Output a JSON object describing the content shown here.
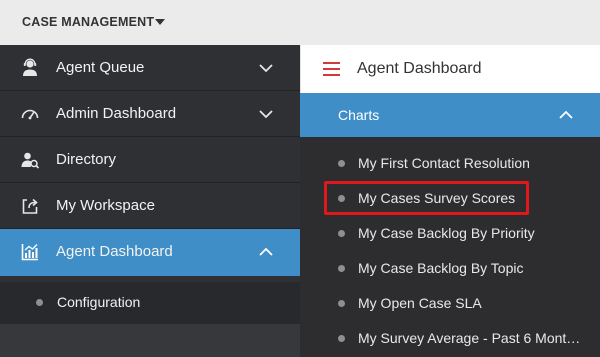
{
  "app": {
    "title": "CASE MANAGEMENT"
  },
  "sidebar": {
    "items": [
      {
        "label": "Agent Queue",
        "icon": "agent-icon",
        "expandable": true
      },
      {
        "label": "Admin Dashboard",
        "icon": "gauge-icon",
        "expandable": true
      },
      {
        "label": "Directory",
        "icon": "directory-search-icon",
        "expandable": false
      },
      {
        "label": "My Workspace",
        "icon": "workspace-export-icon",
        "expandable": false
      },
      {
        "label": "Agent Dashboard",
        "icon": "chart-icon",
        "expandable": true,
        "expanded": true
      }
    ],
    "subitems": [
      {
        "label": "Configuration"
      }
    ]
  },
  "panel": {
    "title": "Agent Dashboard",
    "section": {
      "label": "Charts",
      "expanded": true
    },
    "items": [
      {
        "label": "My First Contact Resolution"
      },
      {
        "label": "My Cases Survey Scores",
        "highlighted": true
      },
      {
        "label": "My Case Backlog By Priority"
      },
      {
        "label": "My Case Backlog By Topic"
      },
      {
        "label": "My Open Case SLA"
      },
      {
        "label": "My Survey Average - Past 6 Mont…"
      }
    ]
  },
  "colors": {
    "accent": "#3f8ec7",
    "sidebar_bg": "#2f3033",
    "highlight_border": "#e0181e",
    "hamburger": "#d23a3a"
  }
}
